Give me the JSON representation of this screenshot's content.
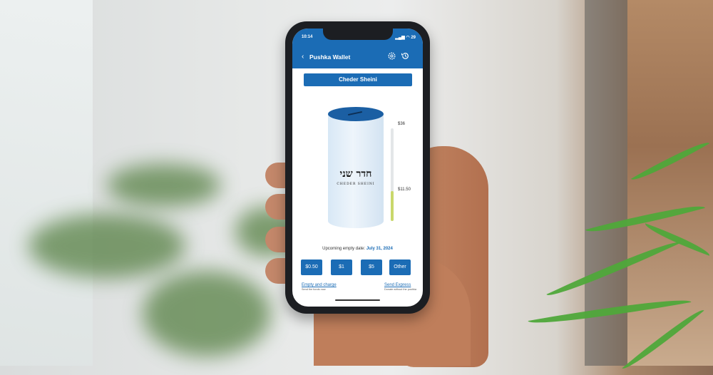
{
  "status_bar": {
    "time": "10:14",
    "battery": "29"
  },
  "app_bar": {
    "back_icon": "chevron-left-icon",
    "title": "Pushka Wallet",
    "settings_icon": "gear-icon",
    "history_icon": "history-icon"
  },
  "pushka": {
    "name": "Cheder Sheini",
    "label_hebrew": "חדר שני",
    "label_english": "CHEDER SHEINI",
    "max_amount": "$36",
    "current_amount": "$11.50",
    "fill_fraction": 0.32
  },
  "upcoming": {
    "prefix": "Upcoming empty date:",
    "date": "July 31, 2024"
  },
  "amounts": [
    "$0.50",
    "$1",
    "$5",
    "Other"
  ],
  "actions": {
    "empty_label": "Empty and charge",
    "empty_sub": "Send the funds now",
    "express_label": "Send Express",
    "express_sub": "Donate without the pushka"
  },
  "colors": {
    "primary": "#1b6cb5",
    "meter_fill": "#c9d86b"
  }
}
